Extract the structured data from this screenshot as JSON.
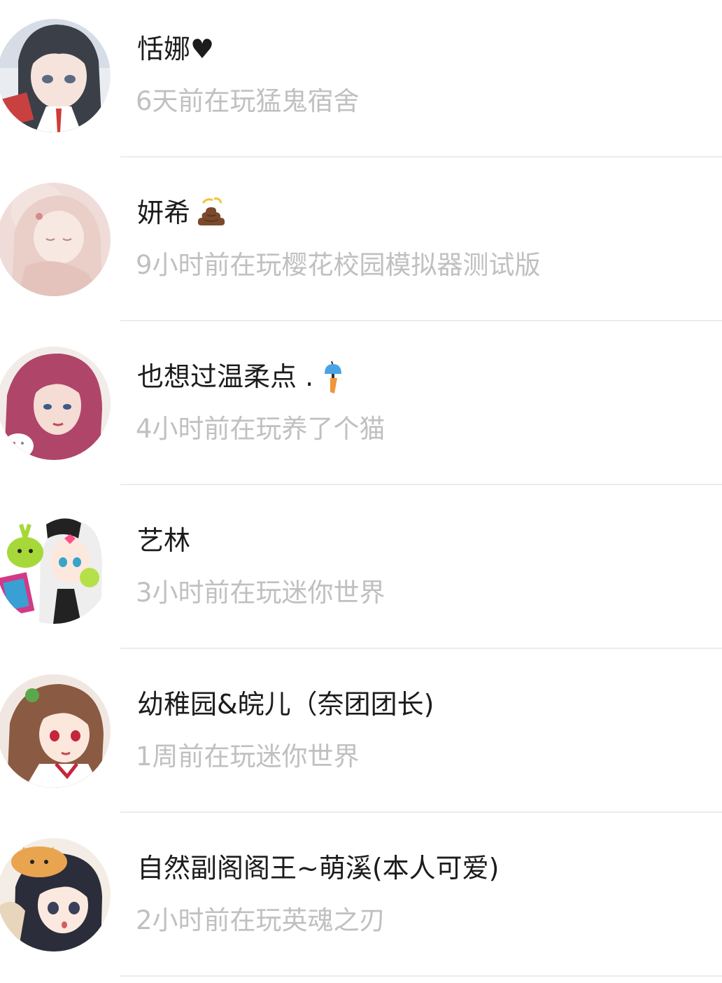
{
  "friends": [
    {
      "name": "恬娜♥",
      "status": "6天前在玩猛鬼宿舍",
      "badge_icon": ""
    },
    {
      "name": "妍希",
      "status": "9小时前在玩樱花校园模拟器测试版",
      "badge_icon": "poop-emoji-icon"
    },
    {
      "name": "也想过温柔点 .",
      "status": "4小时前在玩养了个猫",
      "badge_icon": "wind-chime-icon"
    },
    {
      "name": "艺林",
      "status": "3小时前在玩迷你世界",
      "badge_icon": ""
    },
    {
      "name": "幼稚园&皖儿（奈团团长)",
      "status": "1周前在玩迷你世界",
      "badge_icon": ""
    },
    {
      "name": "自然副阁阁王~萌溪(本人可爱)",
      "status": "2小时前在玩英魂之刃",
      "badge_icon": ""
    }
  ],
  "colors": {
    "name_text": "#1c1c1c",
    "status_text": "#c0c0c0",
    "divider": "#ececec",
    "background": "#ffffff"
  }
}
